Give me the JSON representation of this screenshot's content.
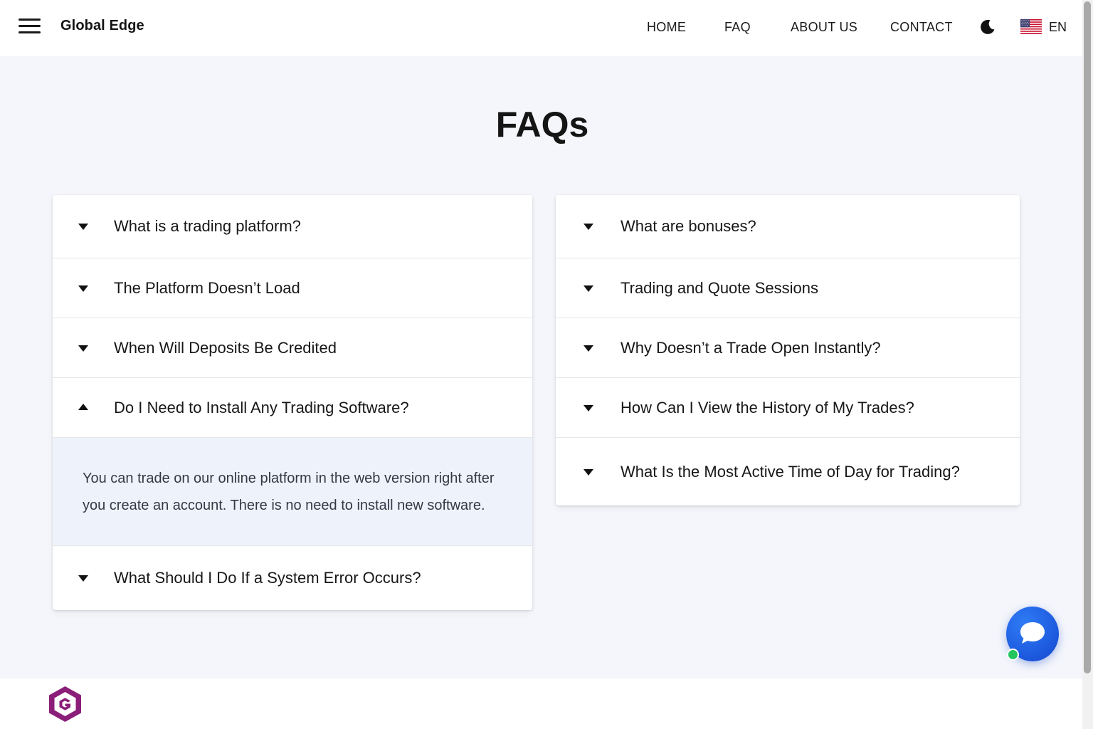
{
  "header": {
    "brand": "Global Edge",
    "nav": [
      "HOME",
      "FAQ",
      "ABOUT US",
      "CONTACT"
    ],
    "language": "EN",
    "menu_icon": "hamburger-menu-icon",
    "theme_icon": "moon-icon",
    "flag_icon": "us-flag-icon"
  },
  "page": {
    "title": "FAQs"
  },
  "faq": {
    "left": [
      {
        "question": "What is a trading platform?",
        "expanded": false
      },
      {
        "question": "The Platform Doesn’t Load",
        "expanded": false
      },
      {
        "question": "When Will Deposits Be Credited",
        "expanded": false
      },
      {
        "question": "Do I Need to Install Any Trading Software?",
        "expanded": true,
        "answer": "You can trade on our online platform in the web version right after you create an account. There is no need to install new software."
      },
      {
        "question": "What Should I Do If a System Error Occurs?",
        "expanded": false
      }
    ],
    "right": [
      {
        "question": "What are bonuses?",
        "expanded": false
      },
      {
        "question": "Trading and Quote Sessions",
        "expanded": false
      },
      {
        "question": "Why Doesn’t a Trade Open Instantly?",
        "expanded": false
      },
      {
        "question": "How Can I View the History of My Trades?",
        "expanded": false
      },
      {
        "question": "What Is the Most Active Time of Day for Trading?",
        "expanded": false
      }
    ]
  },
  "chat": {
    "icon": "chat-bubble-icon",
    "status": "online",
    "status_color": "#22c55e",
    "button_color": "#1c57dc"
  },
  "footer": {
    "logo_icon": "hexagon-g-logo-icon",
    "logo_color": "#8b1e78"
  }
}
